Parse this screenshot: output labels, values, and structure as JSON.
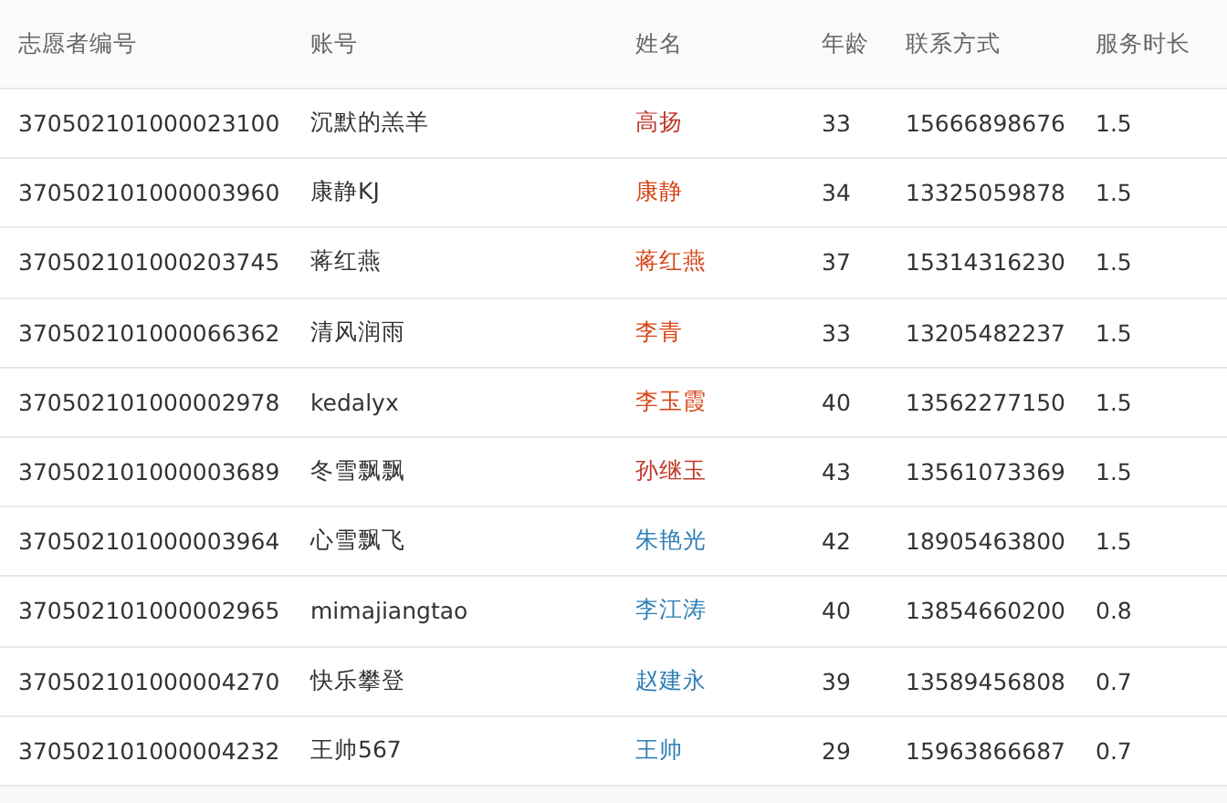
{
  "table": {
    "columns": [
      "志愿者编号",
      "账号",
      "姓名",
      "年龄",
      "联系方式",
      "服务时长"
    ],
    "rows": [
      {
        "id": "370502101000023100",
        "account": "沉默的羔羊",
        "name": "高扬",
        "color": "#c0392b",
        "age": "33",
        "phone": "15666898676",
        "hours": "1.5"
      },
      {
        "id": "370502101000003960",
        "account": "康静KJ",
        "name": "康静",
        "color": "#d84315",
        "age": "34",
        "phone": "13325059878",
        "hours": "1.5"
      },
      {
        "id": "370502101000203745",
        "account": "蒋红燕",
        "name": "蒋红燕",
        "color": "#d84315",
        "age": "37",
        "phone": "15314316230",
        "hours": "1.5"
      },
      {
        "id": "370502101000066362",
        "account": "清风润雨",
        "name": "李青",
        "color": "#d84315",
        "age": "33",
        "phone": "13205482237",
        "hours": "1.5"
      },
      {
        "id": "370502101000002978",
        "account": "kedalyx",
        "name": "李玉霞",
        "color": "#d84315",
        "age": "40",
        "phone": "13562277150",
        "hours": "1.5"
      },
      {
        "id": "370502101000003689",
        "account": "冬雪飘飘",
        "name": "孙继玉",
        "color": "#c0392b",
        "age": "43",
        "phone": "13561073369",
        "hours": "1.5"
      },
      {
        "id": "370502101000003964",
        "account": "心雪飘飞",
        "name": "朱艳光",
        "color": "#2e7fb5",
        "age": "42",
        "phone": "18905463800",
        "hours": "1.5"
      },
      {
        "id": "370502101000002965",
        "account": "mimajiangtao",
        "name": "李江涛",
        "color": "#2e7fb5",
        "age": "40",
        "phone": "13854660200",
        "hours": "0.8"
      },
      {
        "id": "370502101000004270",
        "account": "快乐攀登",
        "name": "赵建永",
        "color": "#2e7fb5",
        "age": "39",
        "phone": "13589456808",
        "hours": "0.7"
      },
      {
        "id": "370502101000004232",
        "account": "王帅567",
        "name": "王帅",
        "color": "#2e7fb5",
        "age": "29",
        "phone": "15963866687",
        "hours": "0.7"
      }
    ]
  }
}
